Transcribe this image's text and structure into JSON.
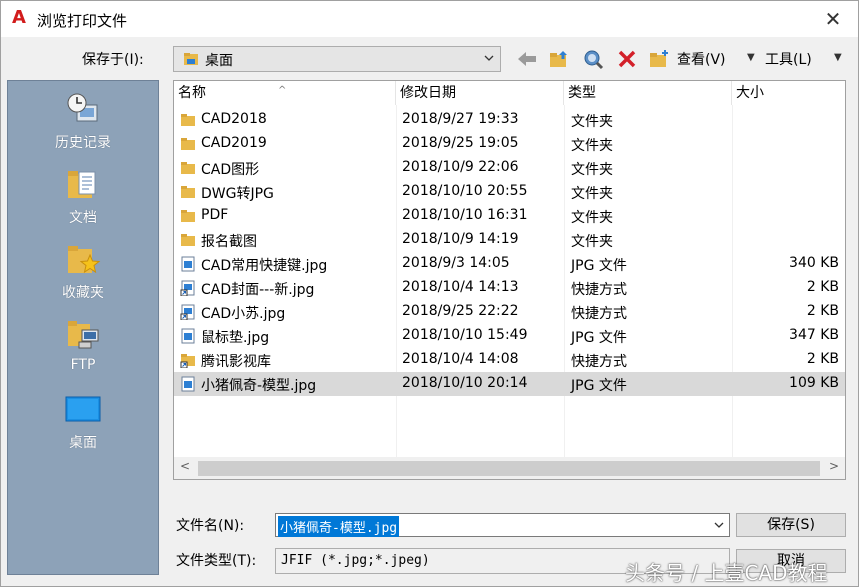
{
  "window": {
    "title": "浏览打印文件",
    "app_icon_glyph": "A",
    "close_glyph": "✕"
  },
  "toolbar": {
    "save_in_label": "保存于(I):",
    "location": "桌面",
    "view_label": "查看(V)",
    "tools_label": "工具(L)"
  },
  "places": [
    {
      "label": "历史记录",
      "icon": "history-icon"
    },
    {
      "label": "文档",
      "icon": "documents-icon"
    },
    {
      "label": "收藏夹",
      "icon": "favorites-icon"
    },
    {
      "label": "FTP",
      "icon": "ftp-icon"
    },
    {
      "label": "桌面",
      "icon": "desktop-icon"
    }
  ],
  "columns": [
    "名称",
    "修改日期",
    "类型",
    "大小"
  ],
  "files": [
    {
      "name": "CAD2018",
      "date": "2018/9/27 19:33",
      "type": "文件夹",
      "size": "",
      "kind": "folder"
    },
    {
      "name": "CAD2019",
      "date": "2018/9/25 19:05",
      "type": "文件夹",
      "size": "",
      "kind": "folder"
    },
    {
      "name": "CAD图形",
      "date": "2018/10/9 22:06",
      "type": "文件夹",
      "size": "",
      "kind": "folder"
    },
    {
      "name": "DWG转JPG",
      "date": "2018/10/10 20:55",
      "type": "文件夹",
      "size": "",
      "kind": "folder"
    },
    {
      "name": "PDF",
      "date": "2018/10/10 16:31",
      "type": "文件夹",
      "size": "",
      "kind": "folder"
    },
    {
      "name": "报名截图",
      "date": "2018/10/9 14:19",
      "type": "文件夹",
      "size": "",
      "kind": "folder"
    },
    {
      "name": "CAD常用快捷键.jpg",
      "date": "2018/9/3 14:05",
      "type": "JPG 文件",
      "size": "340 KB",
      "kind": "image"
    },
    {
      "name": "CAD封面---新.jpg",
      "date": "2018/10/4 14:13",
      "type": "快捷方式",
      "size": "2 KB",
      "kind": "shortcut"
    },
    {
      "name": "CAD小苏.jpg",
      "date": "2018/9/25 22:22",
      "type": "快捷方式",
      "size": "2 KB",
      "kind": "shortcut"
    },
    {
      "name": "鼠标垫.jpg",
      "date": "2018/10/10 15:49",
      "type": "JPG 文件",
      "size": "347 KB",
      "kind": "image"
    },
    {
      "name": "腾讯影视库",
      "date": "2018/10/4 14:08",
      "type": "快捷方式",
      "size": "2 KB",
      "kind": "folder-shortcut"
    },
    {
      "name": "小猪佩奇-模型.jpg",
      "date": "2018/10/10 20:14",
      "type": "JPG 文件",
      "size": "109 KB",
      "kind": "image",
      "selected": true
    }
  ],
  "footer": {
    "filename_label": "文件名(N):",
    "filename_value": "小猪佩奇-模型.jpg",
    "filetype_label": "文件类型(T):",
    "filetype_value": "JFIF (*.jpg;*.jpeg)",
    "save_label": "保存(S)",
    "cancel_label": "取消"
  },
  "watermark": "头条号 / 上壹CAD教程",
  "colors": {
    "places_bg": "#8da2b8",
    "selection": "#0078d7",
    "folder": "#e8b94a",
    "app_icon": "#d21c1c"
  }
}
